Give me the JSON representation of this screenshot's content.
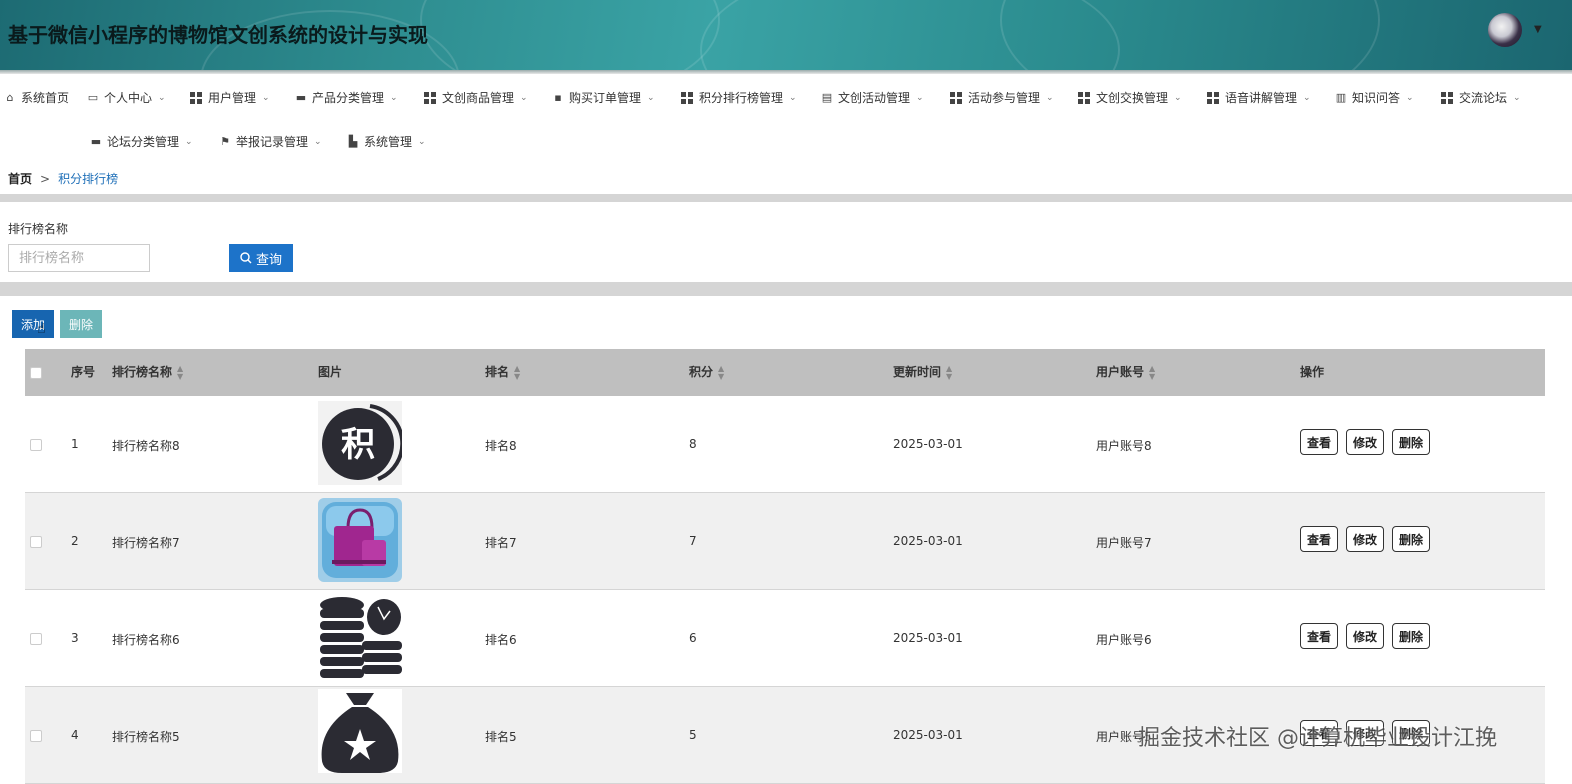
{
  "header": {
    "title": "基于微信小程序的博物馆文创系统的设计与实现"
  },
  "nav": {
    "row1": [
      {
        "label": "系统首页",
        "icon": "home-icon"
      },
      {
        "label": "个人中心",
        "icon": "id-card-icon"
      },
      {
        "label": "用户管理",
        "icon": "grid-icon"
      },
      {
        "label": "产品分类管理",
        "icon": "comment-icon"
      },
      {
        "label": "文创商品管理",
        "icon": "grid-icon"
      },
      {
        "label": "购买订单管理",
        "icon": "briefcase-icon"
      },
      {
        "label": "积分排行榜管理",
        "icon": "grid-icon"
      },
      {
        "label": "文创活动管理",
        "icon": "clipboard-icon"
      },
      {
        "label": "活动参与管理",
        "icon": "grid-icon"
      },
      {
        "label": "文创交换管理",
        "icon": "grid-icon"
      },
      {
        "label": "语音讲解管理",
        "icon": "grid-icon"
      },
      {
        "label": "知识问答",
        "icon": "bar-chart-icon"
      },
      {
        "label": "交流论坛",
        "icon": "grid-icon"
      }
    ],
    "row2": [
      {
        "label": "论坛分类管理",
        "icon": "desktop-icon"
      },
      {
        "label": "举报记录管理",
        "icon": "flag-icon"
      },
      {
        "label": "系统管理",
        "icon": "tools-icon"
      }
    ]
  },
  "breadcrumb": {
    "home": "首页",
    "separator": ">",
    "current": "积分排行榜"
  },
  "search": {
    "label": "排行榜名称",
    "placeholder": "排行榜名称",
    "button_label": "查询"
  },
  "toolbar": {
    "add_label": "添加",
    "delete_label": "删除"
  },
  "table": {
    "headers": {
      "index": "序号",
      "name": "排行榜名称",
      "image": "图片",
      "rank": "排名",
      "score": "积分",
      "updated": "更新时间",
      "account": "用户账号",
      "actions": "操作"
    },
    "rows": [
      {
        "index": "1",
        "name": "排行榜名称8",
        "image": "score-badge-image",
        "rank": "排名8",
        "score": "8",
        "updated": "2025-03-01",
        "account": "用户账号8"
      },
      {
        "index": "2",
        "name": "排行榜名称7",
        "image": "shopping-bag-image",
        "rank": "排名7",
        "score": "7",
        "updated": "2025-03-01",
        "account": "用户账号7"
      },
      {
        "index": "3",
        "name": "排行榜名称6",
        "image": "coins-stack-image",
        "rank": "排名6",
        "score": "6",
        "updated": "2025-03-01",
        "account": "用户账号6"
      },
      {
        "index": "4",
        "name": "排行榜名称5",
        "image": "money-bag-star-image",
        "rank": "排名5",
        "score": "5",
        "updated": "2025-03-01",
        "account": "用户账号5"
      }
    ],
    "action_labels": {
      "view": "查看",
      "edit": "修改",
      "delete": "删除"
    }
  },
  "watermark": "掘金技术社区 @计算机毕业设计江挽",
  "colors": {
    "primary": "#1d73c9",
    "add_button": "#1765b0",
    "delete_button": "#6cb6b8",
    "header_teal": "#2e8d90",
    "table_header": "#bfbfbf"
  }
}
